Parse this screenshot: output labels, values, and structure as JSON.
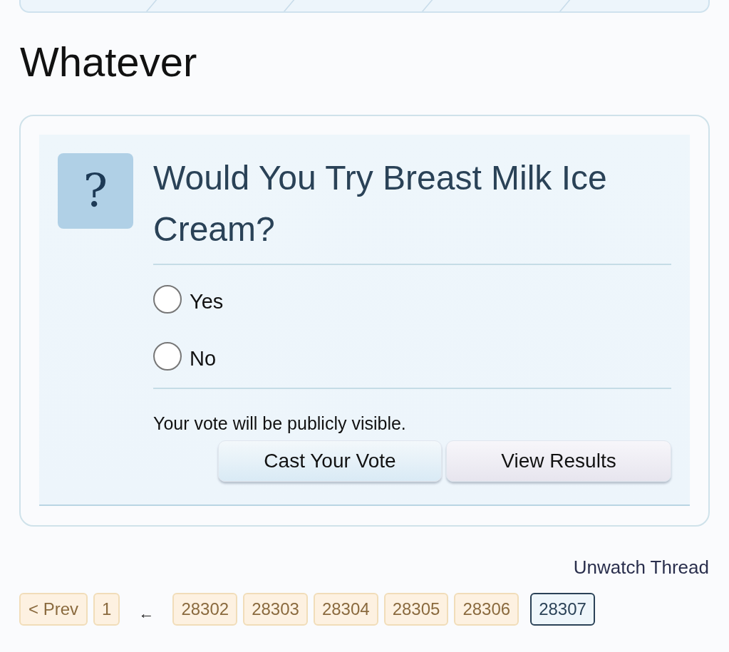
{
  "heading": "Whatever",
  "poll": {
    "icon": "?",
    "question": "Would You Try Breast Milk Ice Cream?",
    "options": [
      {
        "label": "Yes",
        "selected": false
      },
      {
        "label": "No",
        "selected": false
      }
    ],
    "note": "Your vote will be publicly visible.",
    "buttons": [
      {
        "label": "Cast Your Vote",
        "kind": "primary"
      },
      {
        "label": "View Results",
        "kind": "secondary"
      }
    ]
  },
  "watch_link": "Unwatch Thread",
  "pagination": [
    {
      "label": "< Prev",
      "kind": "page",
      "selected": false
    },
    {
      "label": "1",
      "kind": "page",
      "selected": false
    },
    {
      "label": "←",
      "kind": "gap"
    },
    {
      "label": "28302",
      "kind": "page",
      "selected": false
    },
    {
      "label": "28303",
      "kind": "page",
      "selected": false
    },
    {
      "label": "28304",
      "kind": "page",
      "selected": false
    },
    {
      "label": "28305",
      "kind": "page",
      "selected": false
    },
    {
      "label": "28306",
      "kind": "page",
      "selected": false
    },
    {
      "label": "28307",
      "kind": "page",
      "selected": true
    }
  ]
}
